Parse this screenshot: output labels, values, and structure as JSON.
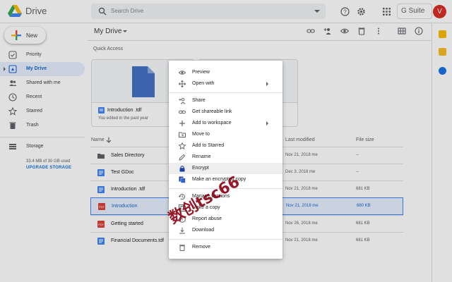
{
  "header": {
    "brand": "Drive",
    "search_placeholder": "Search Drive",
    "gsuite": "G Suite",
    "avatar_initial": "V"
  },
  "sidebar": {
    "new_label": "New",
    "items": [
      {
        "label": "Priority",
        "icon": "check-circle-icon"
      },
      {
        "label": "My Drive",
        "icon": "my-drive-icon",
        "active": true
      },
      {
        "label": "Shared with me",
        "icon": "people-icon"
      },
      {
        "label": "Recent",
        "icon": "clock-icon"
      },
      {
        "label": "Starred",
        "icon": "star-icon"
      },
      {
        "label": "Trash",
        "icon": "trash-icon"
      }
    ],
    "storage": {
      "label": "Storage",
      "usage": "33.4 MB of 30 GB used",
      "upgrade": "UPGRADE STORAGE"
    }
  },
  "main": {
    "title": "My Drive",
    "quick_access": {
      "title": "Quick Access",
      "cards": [
        {
          "name": "Introduction .tdf",
          "sub": "You edited in the past year"
        }
      ]
    },
    "columns": {
      "name": "Name",
      "modified": "Last modified",
      "size": "File size"
    },
    "rows": [
      {
        "name": "Sales Directory",
        "type": "folder",
        "modified": "Nov 21, 2018 me",
        "size": "--"
      },
      {
        "name": "Test GDoc",
        "type": "doc",
        "modified": "Dec 3, 2018 me",
        "size": "--"
      },
      {
        "name": "Introduction .tdf",
        "type": "tdf",
        "modified": "Nov 21, 2018 me",
        "size": "681 KB"
      },
      {
        "name": "Introduction",
        "type": "pdf",
        "modified": "Nov 21, 2018 me",
        "size": "680 KB",
        "selected": true
      },
      {
        "name": "Getting started",
        "type": "pdf",
        "modified": "Nov 26, 2018 me",
        "size": "681 KB"
      },
      {
        "name": "Financial Documents.tdf",
        "type": "tdf",
        "modified": "Nov 21, 2018 me",
        "size": "681 KB"
      }
    ]
  },
  "context_menu": {
    "items": [
      {
        "label": "Preview",
        "icon": "eye-icon"
      },
      {
        "label": "Open with",
        "icon": "move-arrows-icon",
        "submenu": true
      },
      {
        "label": "Share",
        "icon": "add-person-icon"
      },
      {
        "label": "Get shareable link",
        "icon": "link-icon"
      },
      {
        "label": "Add to workspace",
        "icon": "plus-icon",
        "submenu": true
      },
      {
        "label": "Move to",
        "icon": "folder-move-icon"
      },
      {
        "label": "Add to Starred",
        "icon": "star-outline-icon"
      },
      {
        "label": "Rename",
        "icon": "pencil-icon"
      },
      {
        "label": "Encrypt",
        "icon": "lock-icon",
        "highlighted": true
      },
      {
        "label": "Make an encrypted copy",
        "icon": "encrypted-copy-icon"
      },
      {
        "label": "Manage versions",
        "icon": "history-icon"
      },
      {
        "label": "Make a copy",
        "icon": "copy-icon"
      },
      {
        "label": "Report abuse",
        "icon": "report-icon"
      },
      {
        "label": "Download",
        "icon": "download-icon"
      },
      {
        "label": "Remove",
        "icon": "trash-outline-icon"
      }
    ]
  },
  "watermark": "数创tsc66",
  "colors": {
    "accent": "#1a73e8",
    "selected_bg": "#e8f0fe",
    "doc_blue": "#4285f4",
    "pdf_red": "#db4437"
  }
}
